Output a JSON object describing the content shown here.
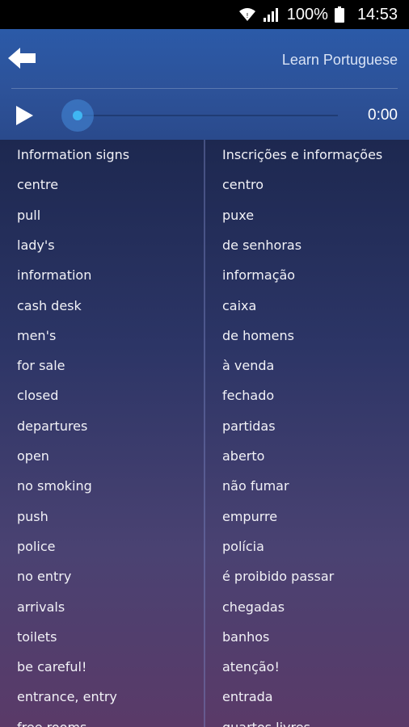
{
  "status_bar": {
    "battery": "100%",
    "time": "14:53",
    "icons": [
      "wifi-icon",
      "signal-icon",
      "battery-icon"
    ]
  },
  "header": {
    "title": "Learn Portuguese",
    "back_icon": "arrow-left-icon",
    "play_icon": "play-icon"
  },
  "player": {
    "time": "0:00",
    "progress": 0
  },
  "colors": {
    "header": "#2b5aa8",
    "accent": "#3fb6f2",
    "text": "#f2f2f7"
  },
  "phrases": [
    {
      "en": "Information signs",
      "pt": "Inscrições e informações"
    },
    {
      "en": "centre",
      "pt": "centro"
    },
    {
      "en": "pull",
      "pt": "puxe"
    },
    {
      "en": "lady's",
      "pt": "de senhoras"
    },
    {
      "en": "information",
      "pt": "informação"
    },
    {
      "en": "cash desk",
      "pt": "caixa"
    },
    {
      "en": "men's",
      "pt": "de homens"
    },
    {
      "en": "for sale",
      "pt": "à venda"
    },
    {
      "en": "closed",
      "pt": "fechado"
    },
    {
      "en": "departures",
      "pt": "partidas"
    },
    {
      "en": "open",
      "pt": "aberto"
    },
    {
      "en": "no smoking",
      "pt": "não fumar"
    },
    {
      "en": "push",
      "pt": "empurre"
    },
    {
      "en": "police",
      "pt": "polícia"
    },
    {
      "en": "no entry",
      "pt": "é proibido passar"
    },
    {
      "en": "arrivals",
      "pt": "chegadas"
    },
    {
      "en": "toilets",
      "pt": "banhos"
    },
    {
      "en": "be careful!",
      "pt": "atenção!"
    },
    {
      "en": "entrance, entry",
      "pt": "entrada"
    },
    {
      "en": "free rooms",
      "pt": "quartos livres"
    }
  ]
}
